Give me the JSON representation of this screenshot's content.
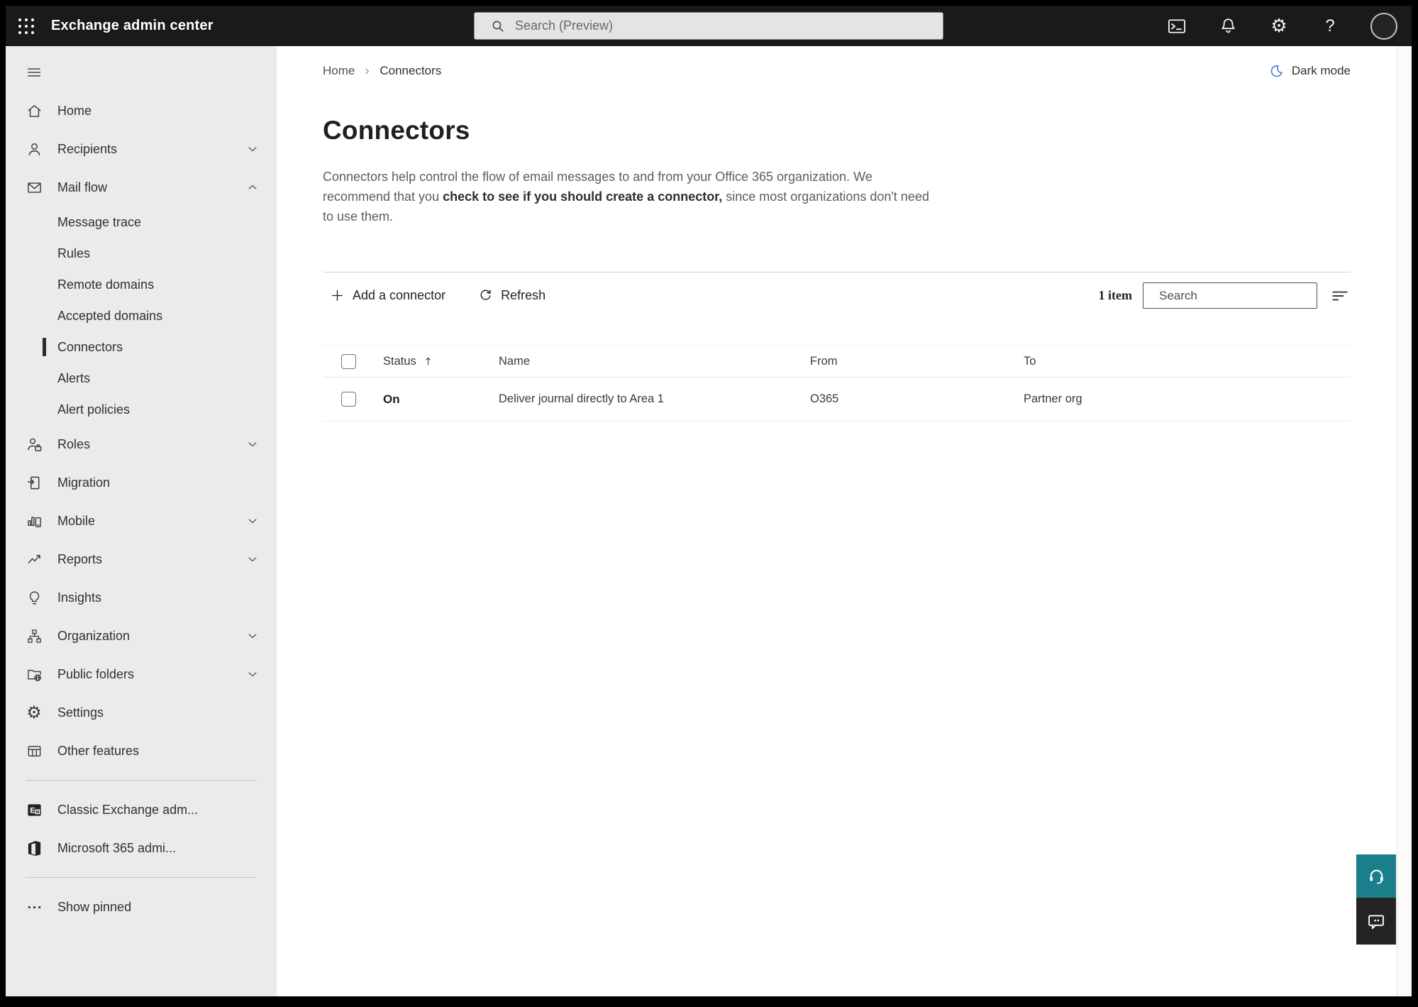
{
  "topbar": {
    "title": "Exchange admin center",
    "search_placeholder": "Search (Preview)",
    "icons": [
      "apps-grid-icon",
      "search-icon",
      "terminal-icon",
      "bell-icon",
      "gear-icon",
      "help-icon",
      "avatar"
    ]
  },
  "sidebar": {
    "items": [
      {
        "label": "Home",
        "icon": "home-icon",
        "type": "top"
      },
      {
        "label": "Recipients",
        "icon": "person-icon",
        "type": "top",
        "chevron": "down"
      },
      {
        "label": "Mail flow",
        "icon": "mail-icon",
        "type": "top",
        "chevron": "up",
        "expanded": true
      },
      {
        "label": "Message trace",
        "type": "sub"
      },
      {
        "label": "Rules",
        "type": "sub"
      },
      {
        "label": "Remote domains",
        "type": "sub"
      },
      {
        "label": "Accepted domains",
        "type": "sub"
      },
      {
        "label": "Connectors",
        "type": "sub",
        "selected": true
      },
      {
        "label": "Alerts",
        "type": "sub"
      },
      {
        "label": "Alert policies",
        "type": "sub"
      },
      {
        "label": "Roles",
        "icon": "roles-icon",
        "type": "top",
        "chevron": "down"
      },
      {
        "label": "Migration",
        "icon": "migration-icon",
        "type": "top"
      },
      {
        "label": "Mobile",
        "icon": "mobile-icon",
        "type": "top",
        "chevron": "down"
      },
      {
        "label": "Reports",
        "icon": "reports-icon",
        "type": "top",
        "chevron": "down"
      },
      {
        "label": "Insights",
        "icon": "insights-icon",
        "type": "top"
      },
      {
        "label": "Organization",
        "icon": "organization-icon",
        "type": "top",
        "chevron": "down"
      },
      {
        "label": "Public folders",
        "icon": "public-folders-icon",
        "type": "top",
        "chevron": "down"
      },
      {
        "label": "Settings",
        "icon": "settings-icon",
        "type": "top"
      },
      {
        "label": "Other features",
        "icon": "other-features-icon",
        "type": "top"
      },
      {
        "label": "Classic Exchange adm...",
        "icon": "exchange-logo-icon",
        "type": "top"
      },
      {
        "label": "Microsoft 365 admi...",
        "icon": "m365-logo-icon",
        "type": "top"
      },
      {
        "label": "Show pinned",
        "icon": "ellipsis-icon",
        "type": "top"
      }
    ]
  },
  "breadcrumb": {
    "home": "Home",
    "current": "Connectors"
  },
  "dark_mode_label": "Dark mode",
  "page": {
    "title": "Connectors",
    "description_before": "Connectors help control the flow of email messages to and from your Office 365 organization. We recommend that you ",
    "description_link": "check to see if you should create a connector,",
    "description_after": " since most organizations don't need to use them."
  },
  "toolbar": {
    "add_label": "Add a connector",
    "refresh_label": "Refresh",
    "count": "1 item",
    "search_placeholder": "Search"
  },
  "table": {
    "headers": {
      "status": "Status",
      "name": "Name",
      "from": "From",
      "to": "To"
    },
    "rows": [
      {
        "status": "On",
        "name": "Deliver journal directly to Area 1",
        "from": "O365",
        "to": "Partner org"
      }
    ]
  },
  "colors": {
    "topbar_bg": "#1b1a19",
    "sidebar_bg": "#ebebeb",
    "accent_teal": "#1a7f8b",
    "feedback_dark": "#252423",
    "moon_blue": "#4080d0",
    "text_primary": "#323130",
    "text_secondary": "#5f5d5b"
  }
}
